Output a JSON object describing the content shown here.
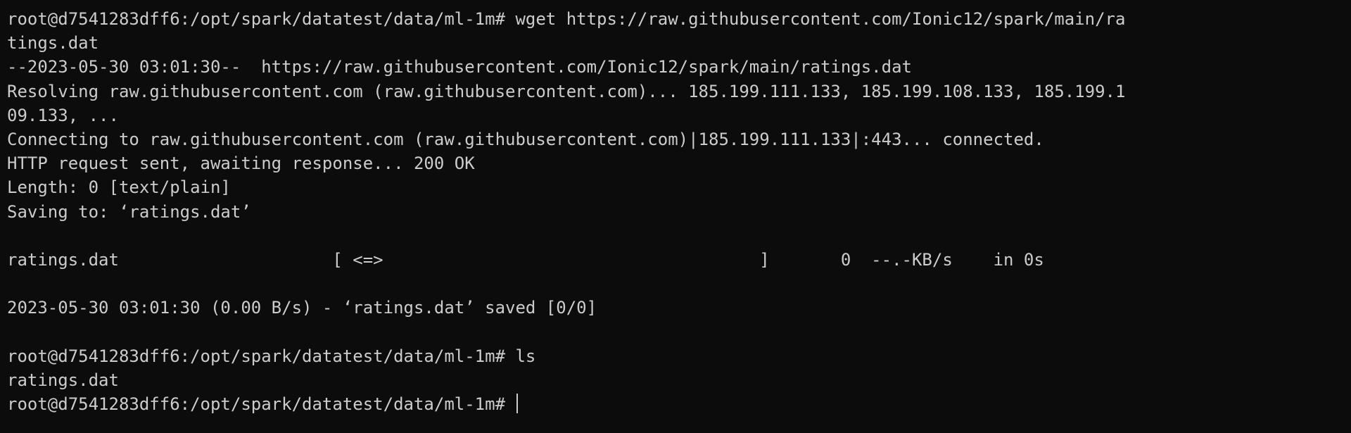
{
  "terminal": {
    "lines": [
      "root@d7541283dff6:/opt/spark/datatest/data/ml-1m# wget https://raw.githubusercontent.com/Ionic12/spark/main/ra",
      "tings.dat",
      "--2023-05-30 03:01:30--  https://raw.githubusercontent.com/Ionic12/spark/main/ratings.dat",
      "Resolving raw.githubusercontent.com (raw.githubusercontent.com)... 185.199.111.133, 185.199.108.133, 185.199.1",
      "09.133, ...",
      "Connecting to raw.githubusercontent.com (raw.githubusercontent.com)|185.199.111.133|:443... connected.",
      "HTTP request sent, awaiting response... 200 OK",
      "Length: 0 [text/plain]",
      "Saving to: ‘ratings.dat’",
      "",
      "ratings.dat                     [ <=>                                     ]       0  --.-KB/s    in 0s",
      "",
      "2023-05-30 03:01:30 (0.00 B/s) - ‘ratings.dat’ saved [0/0]",
      "",
      "root@d7541283dff6:/opt/spark/datatest/data/ml-1m# ls",
      "ratings.dat"
    ],
    "prompt": "root@d7541283dff6:/opt/spark/datatest/data/ml-1m# "
  }
}
